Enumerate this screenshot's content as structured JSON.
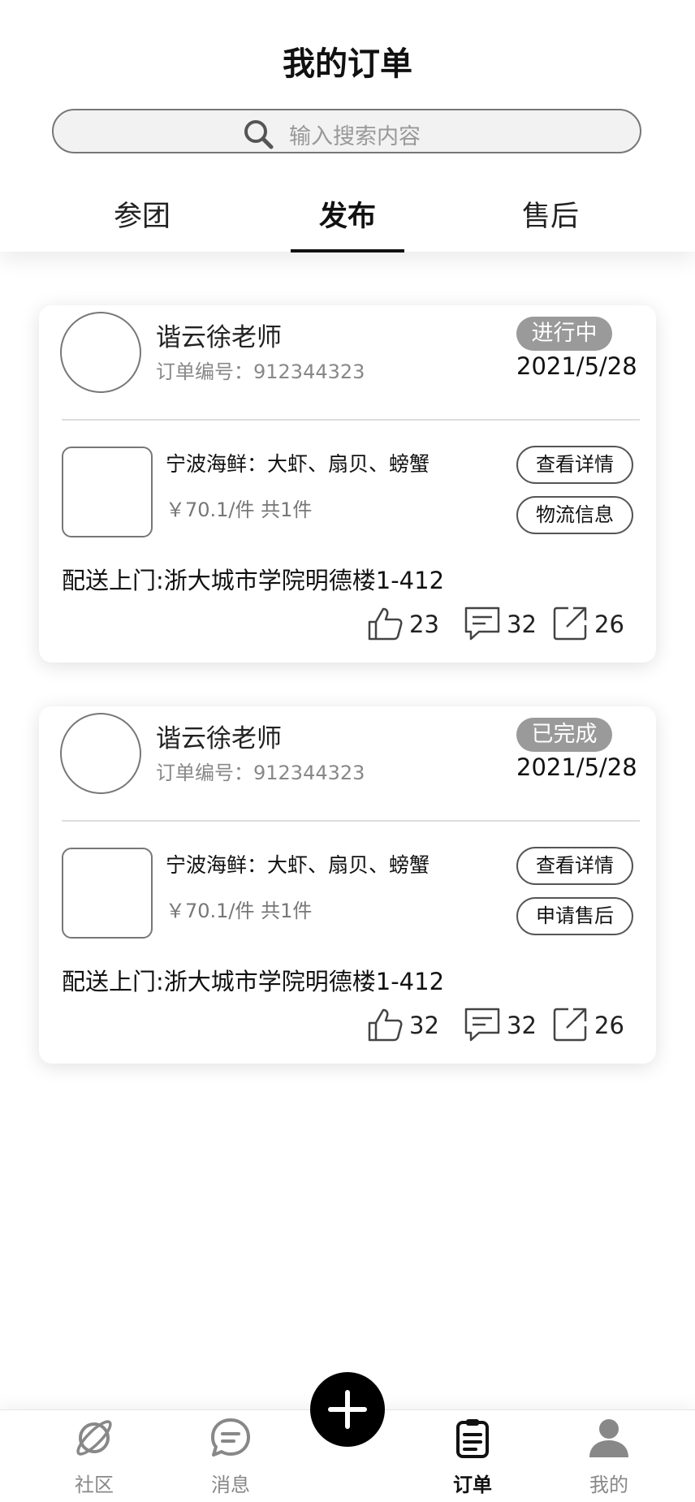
{
  "page": {
    "title": "我的订单"
  },
  "search": {
    "placeholder": "输入搜索内容"
  },
  "tabs": [
    {
      "label": "参团",
      "active": false
    },
    {
      "label": "发布",
      "active": true
    },
    {
      "label": "售后",
      "active": false
    }
  ],
  "orders": [
    {
      "user_name": "谐云徐老师",
      "order_no": "订单编号：912344323",
      "status": "进行中",
      "date": "2021/5/28",
      "product_name": "宁波海鲜：大虾、扇贝、螃蟹",
      "price_qty": "￥70.1/件 共1件",
      "buttons": [
        "查看详情",
        "物流信息"
      ],
      "address": "配送上门:浙大城市学院明德楼1-412",
      "likes": "23",
      "comments": "32",
      "shares": "26"
    },
    {
      "user_name": "谐云徐老师",
      "order_no": "订单编号：912344323",
      "status": "已完成",
      "date": "2021/5/28",
      "product_name": "宁波海鲜：大虾、扇贝、螃蟹",
      "price_qty": "￥70.1/件 共1件",
      "buttons": [
        "查看详情",
        "申请售后"
      ],
      "address": "配送上门:浙大城市学院明德楼1-412",
      "likes": "32",
      "comments": "32",
      "shares": "26"
    }
  ],
  "bottom_nav": [
    {
      "label": "社区",
      "icon": "planet-icon",
      "active": false
    },
    {
      "label": "消息",
      "icon": "message-icon",
      "active": false
    },
    {
      "label": "订单",
      "icon": "clipboard-icon",
      "active": true
    },
    {
      "label": "我的",
      "icon": "person-icon",
      "active": false
    }
  ],
  "fab": {
    "icon": "plus-icon"
  },
  "colors": {
    "status_badge": "#9a9a9a",
    "accent": "#000000",
    "inactive_text": "#888888"
  }
}
